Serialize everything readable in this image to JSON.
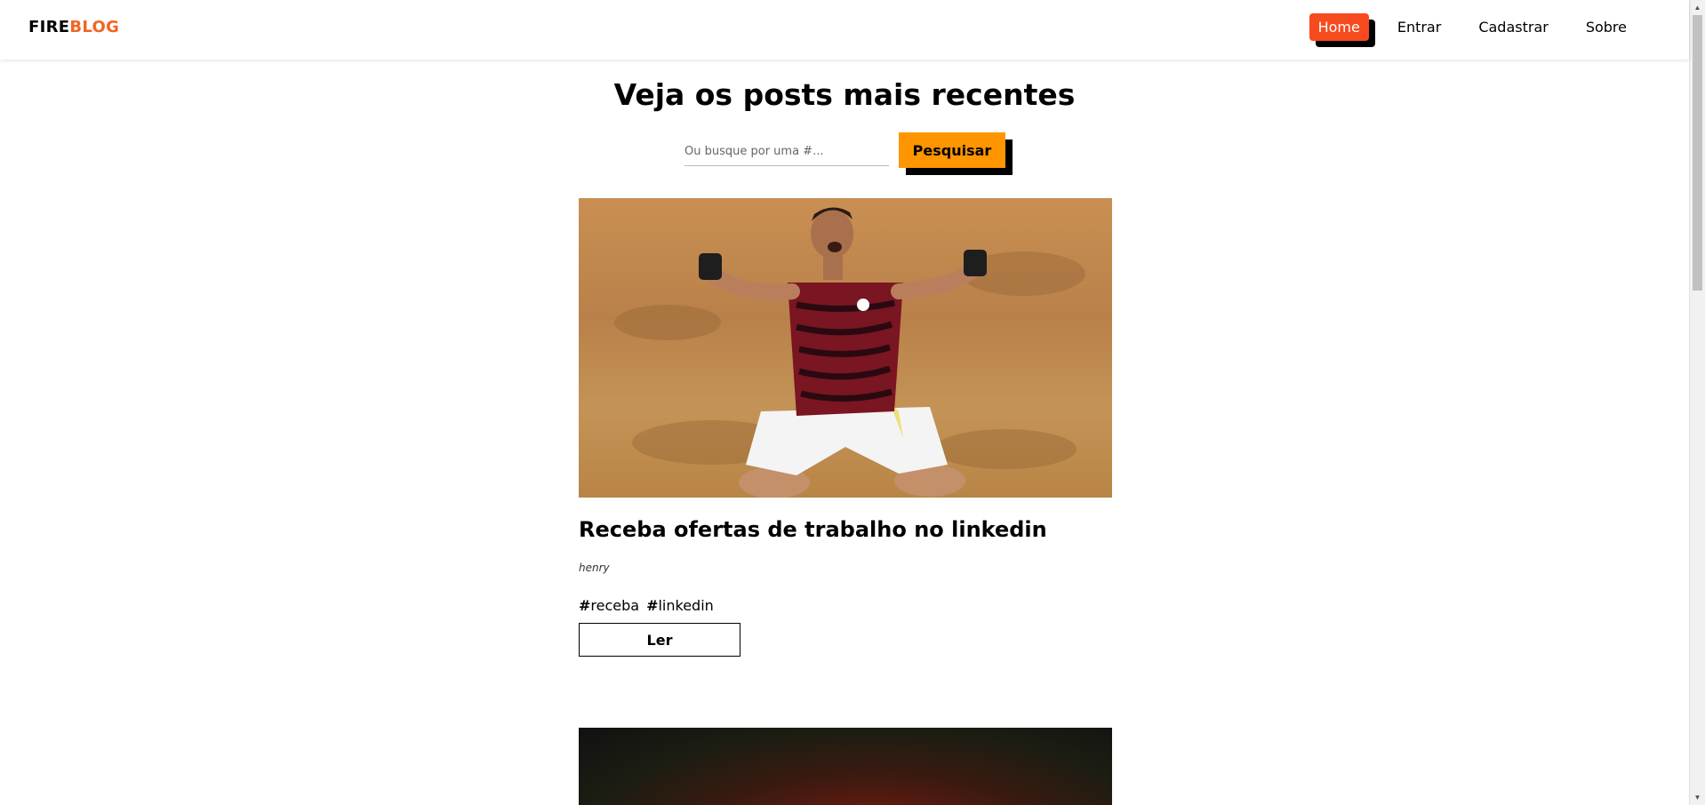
{
  "navbar": {
    "brand_part1": "FIRE",
    "brand_part2": "BLOG",
    "links": [
      {
        "label": "Home",
        "active": true
      },
      {
        "label": "Entrar",
        "active": false
      },
      {
        "label": "Cadastrar",
        "active": false
      },
      {
        "label": "Sobre",
        "active": false
      }
    ]
  },
  "main": {
    "title": "Veja os posts mais recentes",
    "search": {
      "placeholder": "Ou busque por uma #...",
      "value": "",
      "button_label": "Pesquisar"
    },
    "posts": [
      {
        "title": "Receba ofertas de trabalho no linkedin",
        "author": "henry",
        "tags": [
          "receba",
          "linkedin"
        ],
        "read_label": "Ler"
      }
    ]
  },
  "colors": {
    "brand_accent": "#f26522",
    "active_nav": "#f74a1e",
    "search_button": "#ff9500"
  }
}
